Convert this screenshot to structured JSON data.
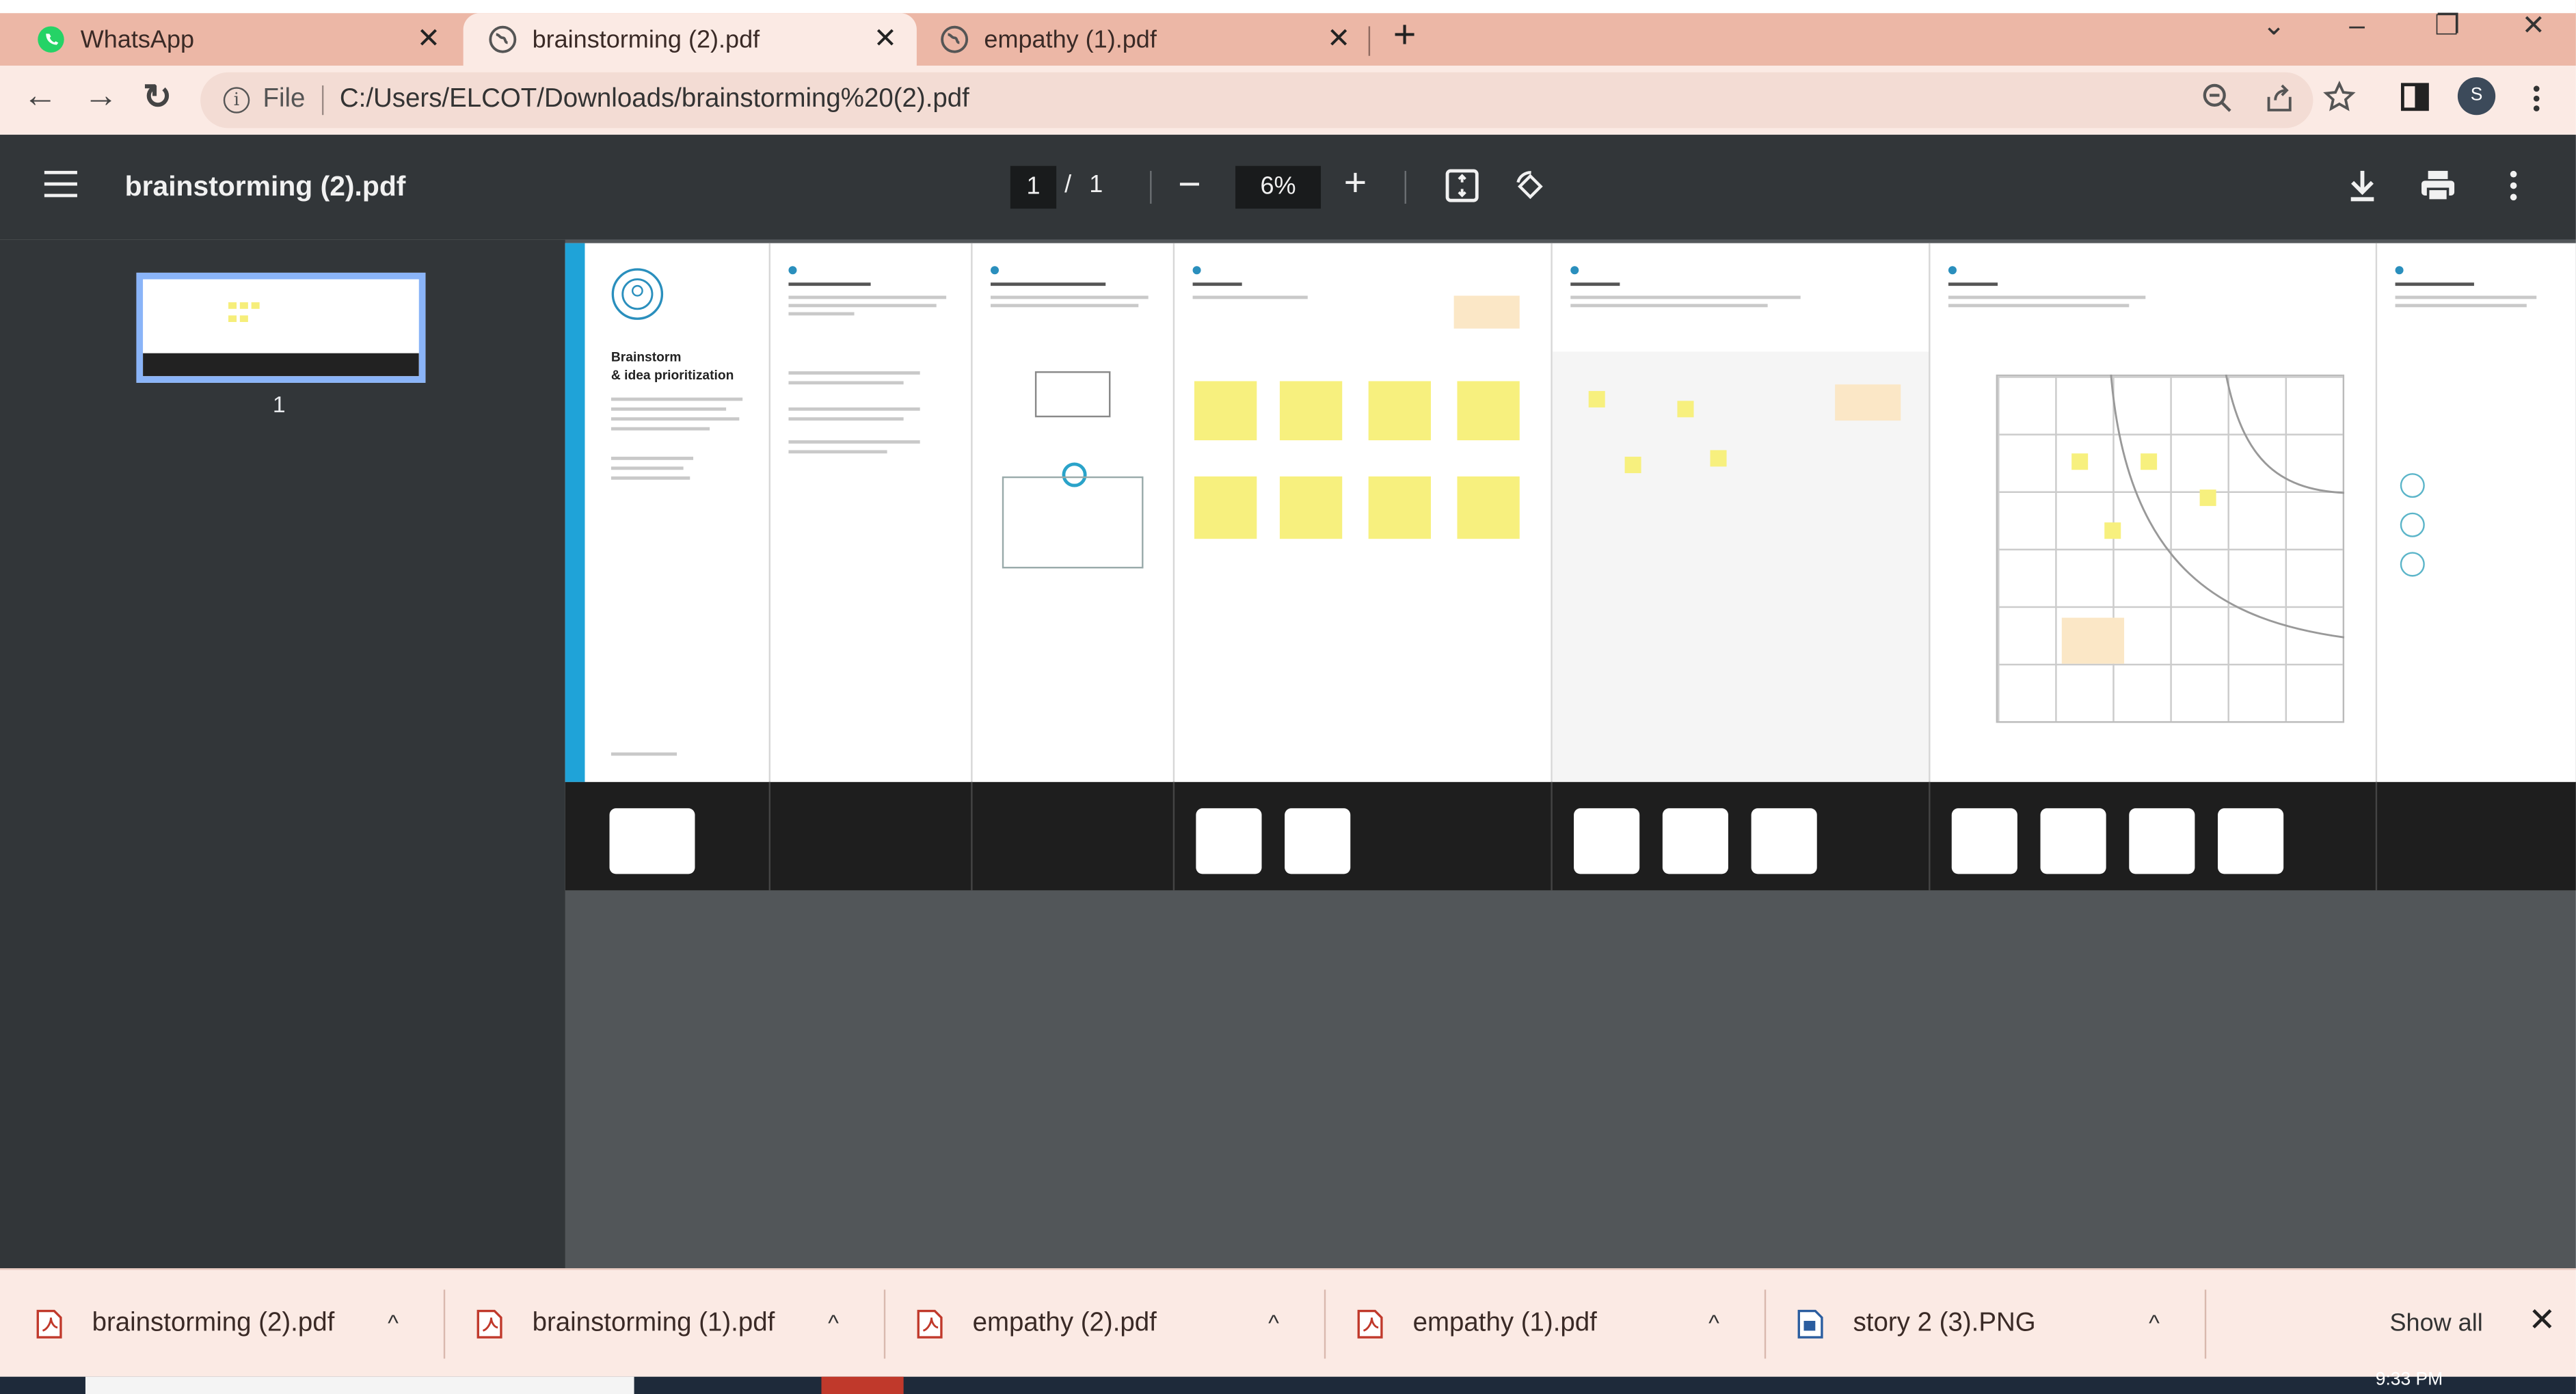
{
  "tabs": [
    {
      "label": "WhatsApp",
      "icon": "whatsapp-icon"
    },
    {
      "label": "brainstorming (2).pdf",
      "icon": "globe-icon",
      "active": true
    },
    {
      "label": "empathy (1).pdf",
      "icon": "globe-icon"
    }
  ],
  "tab_close": "✕",
  "new_tab": "+",
  "window_controls": {
    "list": "⌄",
    "minimize": "–",
    "restore": "❐",
    "close": "✕"
  },
  "omnibox": {
    "security": "i",
    "scheme": "File",
    "url": "C:/Users/ELCOT/Downloads/brainstorming%20(2).pdf"
  },
  "profile": {
    "initial": "S"
  },
  "pdf": {
    "title": "brainstorming (2).pdf",
    "page_current": "1",
    "page_sep": "/",
    "page_total": "1",
    "zoom": "6%",
    "zoom_out": "−",
    "zoom_in": "+",
    "thumbnail_label": "1"
  },
  "page_content": {
    "heading_line1": "Brainstorm",
    "heading_line2": "& idea prioritization"
  },
  "downloads": [
    {
      "name": "brainstorming (2).pdf",
      "type": "pdf"
    },
    {
      "name": "brainstorming (1).pdf",
      "type": "pdf"
    },
    {
      "name": "empathy (2).pdf",
      "type": "pdf"
    },
    {
      "name": "empathy (1).pdf",
      "type": "pdf"
    },
    {
      "name": "story 2 (3).PNG",
      "type": "image"
    }
  ],
  "downloads_bar": {
    "show_all": "Show all",
    "chevron": "^",
    "close": "✕"
  },
  "taskbar": {
    "clock": "9:33 PM"
  },
  "colors": {
    "tabstrip": "#ecb7a6",
    "toolbar": "#fbeae4",
    "pdf_toolbar": "#323639",
    "viewer_bg": "#525659",
    "accent": "#8ab4f8",
    "sticky": "#f7f07e"
  }
}
